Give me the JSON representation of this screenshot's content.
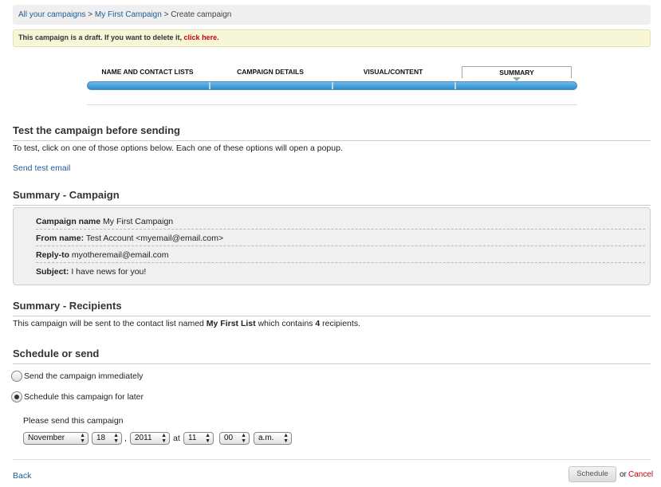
{
  "breadcrumb": {
    "item1": "All your campaigns",
    "sep": ">",
    "item2": "My First Campaign",
    "current": "Create campaign"
  },
  "draft_notice": {
    "text": "This campaign is a draft. If you want to delete it,",
    "link": "click here."
  },
  "wizard": {
    "steps": [
      "NAME AND CONTACT LISTS",
      "CAMPAIGN DETAILS",
      "VISUAL/CONTENT",
      "SUMMARY"
    ],
    "active_step": "SUMMARY",
    "progress_fraction": 1.0
  },
  "test_section": {
    "title": "Test the campaign before sending",
    "description": "To test, click on one of those options below. Each one of these options will open a popup.",
    "send_test_link": "Send test email"
  },
  "summary_campaign": {
    "title": "Summary - Campaign",
    "rows": [
      {
        "label": "Campaign name",
        "value": "My First Campaign"
      },
      {
        "label": "From name:",
        "value": "Test Account <myemail@email.com>"
      },
      {
        "label": "Reply-to",
        "value": "myotheremail@email.com"
      },
      {
        "label": "Subject:",
        "value": "I have news for you!"
      }
    ]
  },
  "summary_recipients": {
    "title": "Summary - Recipients",
    "text_before": "This campaign will be sent to the contact list named",
    "list_name": "My First List",
    "text_middle": "which contains",
    "count": "4",
    "text_after": "recipients."
  },
  "schedule": {
    "title": "Schedule or send",
    "option_immediate": "Send the campaign immediately",
    "option_later": "Schedule this campaign for later",
    "selected": "later",
    "prompt": "Please send this campaign",
    "month": "November",
    "day": "18",
    "comma": ",",
    "year": "2011",
    "at": "at",
    "hour": "11",
    "minute": "00",
    "ampm": "a.m."
  },
  "footer": {
    "back": "Back",
    "schedule_button": "Schedule",
    "or": "or",
    "cancel": "Cancel"
  },
  "colors": {
    "link": "#1e5c99",
    "danger": "#c8000a",
    "progress": "#2f8ccc"
  }
}
